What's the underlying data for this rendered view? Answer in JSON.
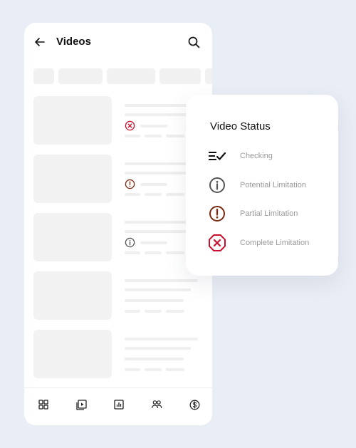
{
  "header": {
    "title": "Videos",
    "back_icon": "arrow-left-icon",
    "search_icon": "search-icon"
  },
  "rows": [
    {
      "status": "complete"
    },
    {
      "status": "partial"
    },
    {
      "status": "potential"
    },
    {
      "status": "none"
    },
    {
      "status": "none"
    }
  ],
  "bottom_nav": {
    "items": [
      "dashboard-icon",
      "video-library-icon",
      "analytics-icon",
      "community-icon",
      "earnings-icon"
    ]
  },
  "status_card": {
    "title": "Video Status",
    "items": [
      {
        "key": "checking",
        "label": "Checking",
        "icon": "checking-icon"
      },
      {
        "key": "potential",
        "label": "Potential Limitation",
        "icon": "info-icon"
      },
      {
        "key": "partial",
        "label": "Partial Limitation",
        "icon": "exclamation-icon"
      },
      {
        "key": "complete",
        "label": "Complete Limitation",
        "icon": "octagon-x-icon"
      }
    ]
  },
  "colors": {
    "complete": "#c8102e",
    "partial": "#7a2a10",
    "potential": "#555555",
    "checking": "#111111"
  }
}
